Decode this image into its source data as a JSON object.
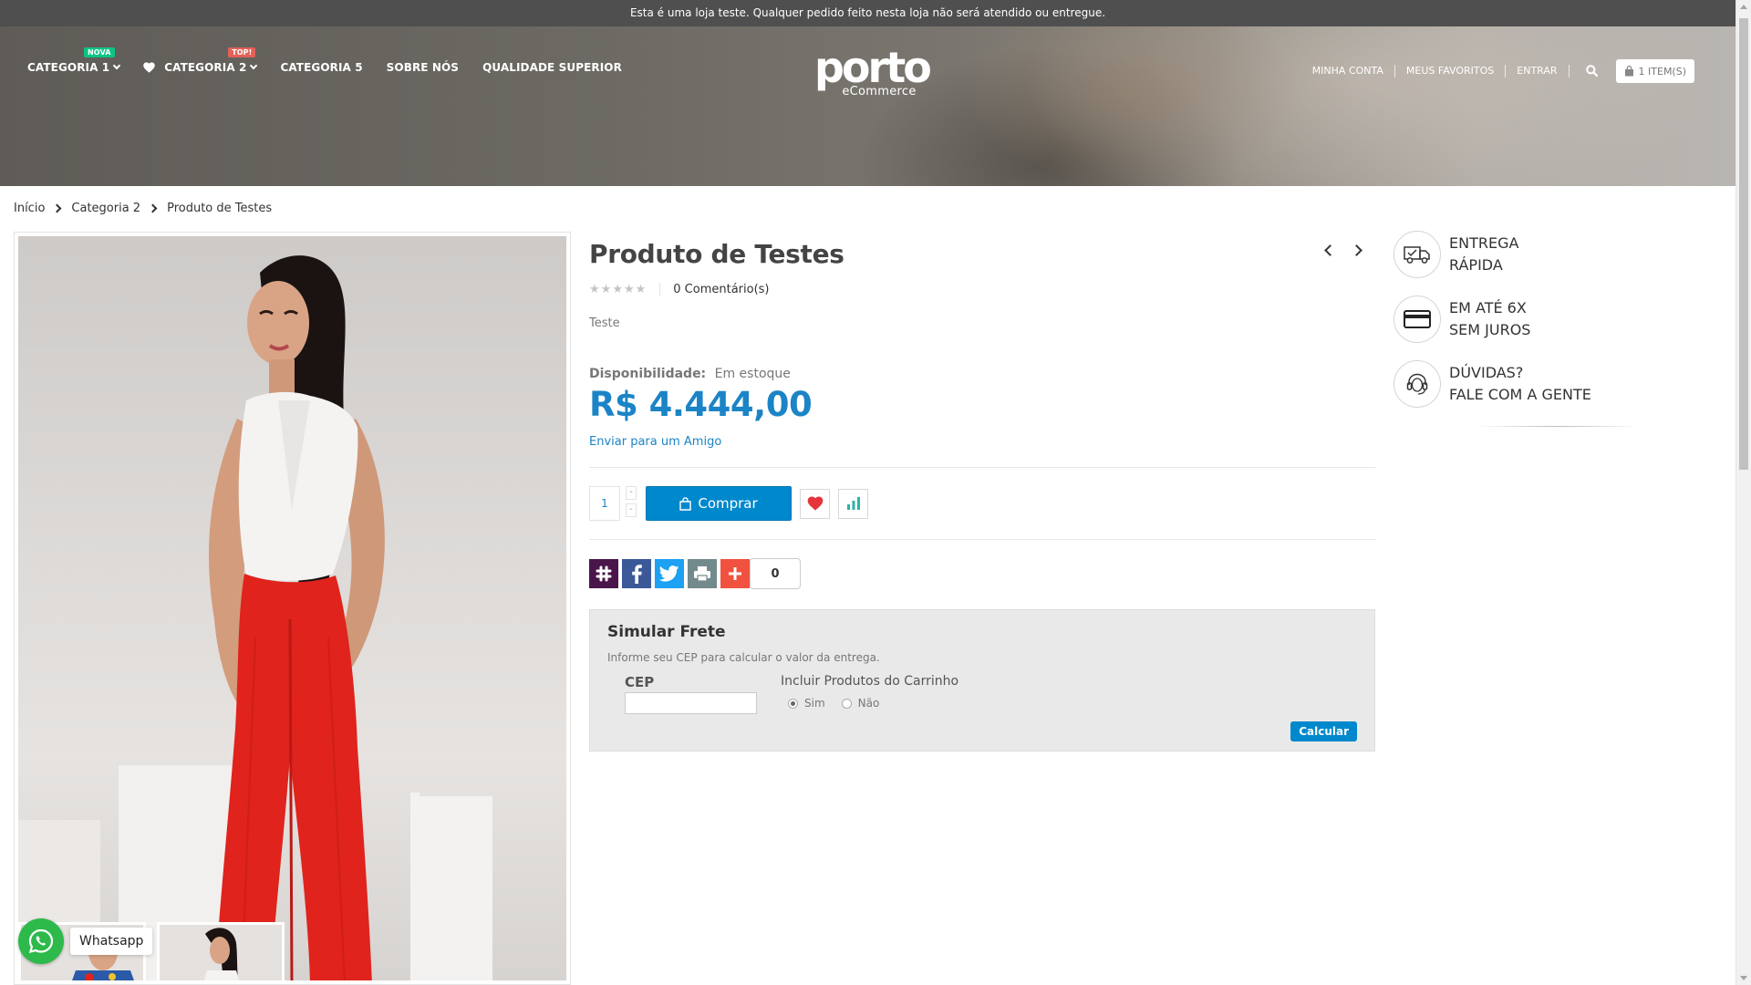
{
  "notice": "Esta é uma loja teste. Qualquer pedido feito nesta loja não será atendido ou entregue.",
  "nav": {
    "items": [
      {
        "label": "CATEGORIA 1",
        "badge": "NOVA"
      },
      {
        "label": "CATEGORIA 2",
        "badge": "TOP!"
      },
      {
        "label": "CATEGORIA 5"
      },
      {
        "label": "SOBRE NÓS"
      },
      {
        "label": "QUALIDADE SUPERIOR"
      }
    ]
  },
  "logo": {
    "main": "porto",
    "sub": "eCommerce"
  },
  "top_links": {
    "account": "MINHA CONTA",
    "favorites": "MEUS FAVORITOS",
    "login": "ENTRAR",
    "cart": "1 ITEM(S)"
  },
  "breadcrumb": [
    "Início",
    "Categoria 2",
    "Produto de Testes"
  ],
  "product": {
    "title": "Produto de Testes",
    "rating": 0,
    "comments": "0 Comentário(s)",
    "short_description": "Teste",
    "availability_label": "Disponibilidade:",
    "availability_value": "Em estoque",
    "price": "R$ 4.444,00",
    "send_friend": "Enviar para um Amigo",
    "quantity": "1",
    "qty_minus": "-",
    "qty_plus": "-",
    "buy_label": "Comprar",
    "share_count": "0"
  },
  "freight": {
    "title": "Simular Frete",
    "description": "Informe seu CEP para calcular o valor da entrega.",
    "cep_label": "CEP",
    "cep_value": "",
    "include_label": "Incluir Produtos do Carrinho",
    "option_yes": "Sim",
    "option_no": "Não",
    "selected": "Sim",
    "calc_label": "Calcular"
  },
  "side_info": [
    {
      "icon": "truck-icon",
      "text": "ENTREGA\nRÁPIDA"
    },
    {
      "icon": "credit-card-icon",
      "text": "EM ATÉ 6X\nSEM JUROS"
    },
    {
      "icon": "headset-icon",
      "text": "DÚVIDAS?\nFALE COM A GENTE"
    }
  ],
  "whatsapp": {
    "label": "Whatsapp"
  },
  "colors": {
    "accent": "#0088cc",
    "price": "#1b84c6",
    "badge_new": "#0cc485",
    "badge_top": "#e36159",
    "slack": "#4a154b",
    "facebook": "#3b5998",
    "twitter": "#1da1f2",
    "print": "#738a8d",
    "more": "#f0523f",
    "whatsapp": "#2dba4a"
  }
}
